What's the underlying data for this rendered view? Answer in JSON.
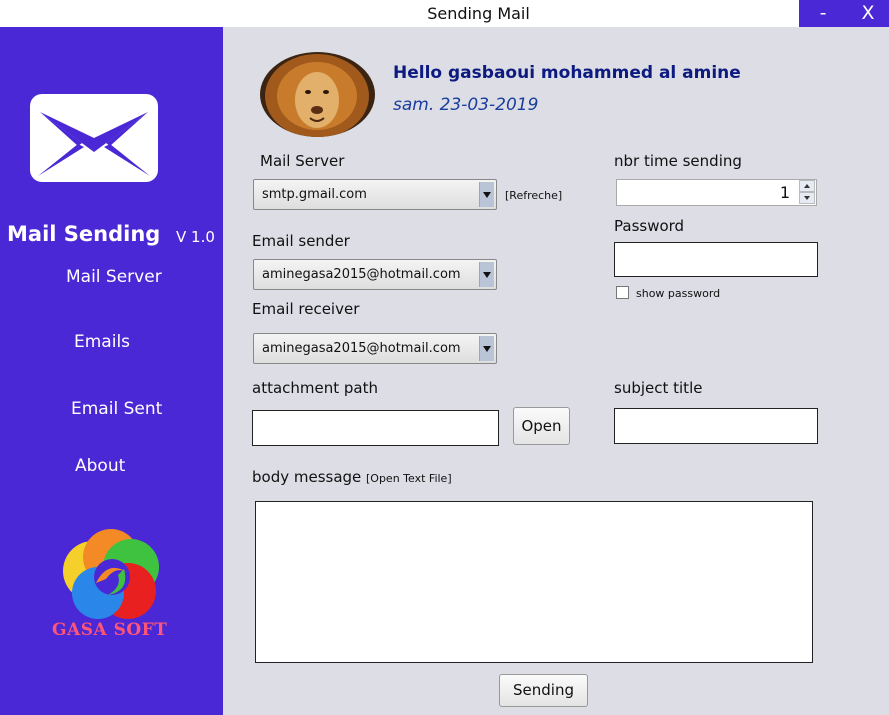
{
  "window": {
    "title": "Sending Mail",
    "minimize_label": "-",
    "close_label": "X"
  },
  "sidebar": {
    "app_name": "Mail Sending",
    "version": "V 1.0",
    "nav": [
      {
        "label": "Mail Server"
      },
      {
        "label": "Emails"
      },
      {
        "label": "Email Sent"
      },
      {
        "label": "About"
      }
    ],
    "brand": "GASA SOFT"
  },
  "header": {
    "greeting": "Hello gasbaoui mohammed al amine",
    "date": "sam. 23-03-2019"
  },
  "form": {
    "mail_server": {
      "label": "Mail Server",
      "value": "smtp.gmail.com",
      "refresh_label": "[Refreche]"
    },
    "email_sender": {
      "label": "Email sender",
      "value": "aminegasa2015@hotmail.com"
    },
    "email_receiver": {
      "label": "Email receiver",
      "value": "aminegasa2015@hotmail.com"
    },
    "nbr_time_sending": {
      "label": "nbr time sending",
      "value": "1"
    },
    "password": {
      "label": "Password",
      "value": "",
      "show_password_label": "show password",
      "show_password_checked": false
    },
    "attachment": {
      "label": "attachment path",
      "value": "",
      "open_label": "Open"
    },
    "subject": {
      "label": "subject title",
      "value": ""
    },
    "body": {
      "label": "body message",
      "open_text_file_label": "[Open Text File]",
      "value": ""
    },
    "send_label": "Sending"
  },
  "colors": {
    "sidebar": "#4a28d6",
    "main_bg": "#dcdde5",
    "greeting": "#0d1a80",
    "date": "#1a3e9e",
    "brand_text": "#ff5577"
  },
  "icons": {
    "mail": "envelope-icon",
    "avatar": "lion-avatar",
    "brand_logo": "gasa-soft-logo"
  }
}
